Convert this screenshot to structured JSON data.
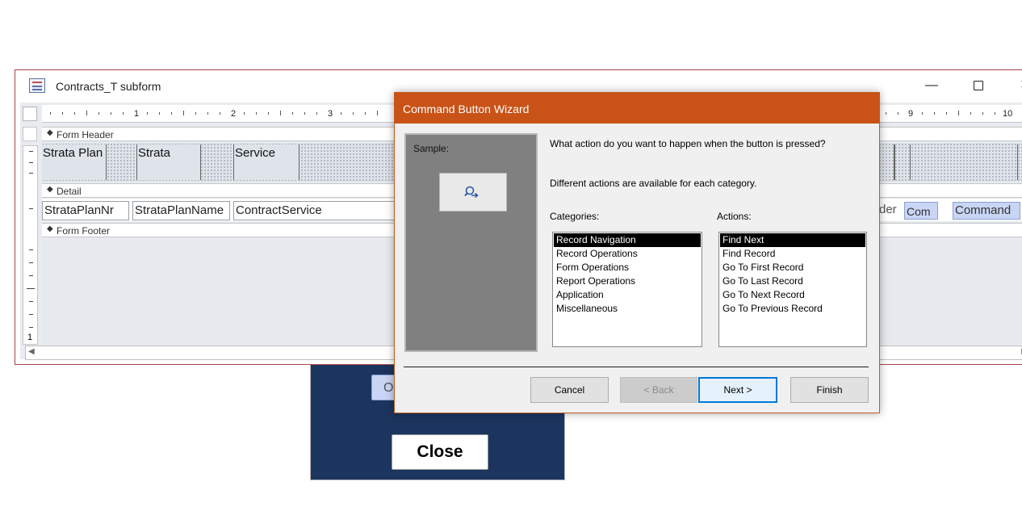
{
  "background_form": {
    "open_button_partial": "O",
    "close_button": "Close"
  },
  "subform_window": {
    "title": "Contracts_T subform",
    "icon": "form-icon",
    "controls": {
      "minimize": "—",
      "close": "✕"
    },
    "ruler_numbers": [
      "1",
      "2",
      "3",
      "9",
      "10"
    ],
    "vertical_ruler_number": "1",
    "sections": {
      "form_header": "Form Header",
      "detail": "Detail",
      "form_footer": "Form Footer"
    },
    "header_labels": [
      "Strata Plan",
      "Strata",
      "Service"
    ],
    "detail_fields": [
      "StrataPlanNr",
      "StrataPlanName",
      "ContractService"
    ],
    "right_fragments": {
      "detail_text": "der",
      "com_button": "Com",
      "command_button": "Command"
    }
  },
  "wizard": {
    "title": "Command Button Wizard",
    "sample_label": "Sample:",
    "sample_icon": "find-next-icon",
    "question": "What action do you want to happen when the button is pressed?",
    "hint": "Different actions are available for each category.",
    "categories_label": "Categories:",
    "actions_label": "Actions:",
    "categories": [
      "Record Navigation",
      "Record Operations",
      "Form Operations",
      "Report Operations",
      "Application",
      "Miscellaneous"
    ],
    "selected_category": "Record Navigation",
    "actions": [
      "Find Next",
      "Find Record",
      "Go To First Record",
      "Go To Last Record",
      "Go To Next Record",
      "Go To Previous Record"
    ],
    "selected_action": "Find Next",
    "buttons": {
      "cancel": "Cancel",
      "back": "< Back",
      "next": "Next >",
      "finish": "Finish"
    },
    "accent_color": "#c95217"
  }
}
